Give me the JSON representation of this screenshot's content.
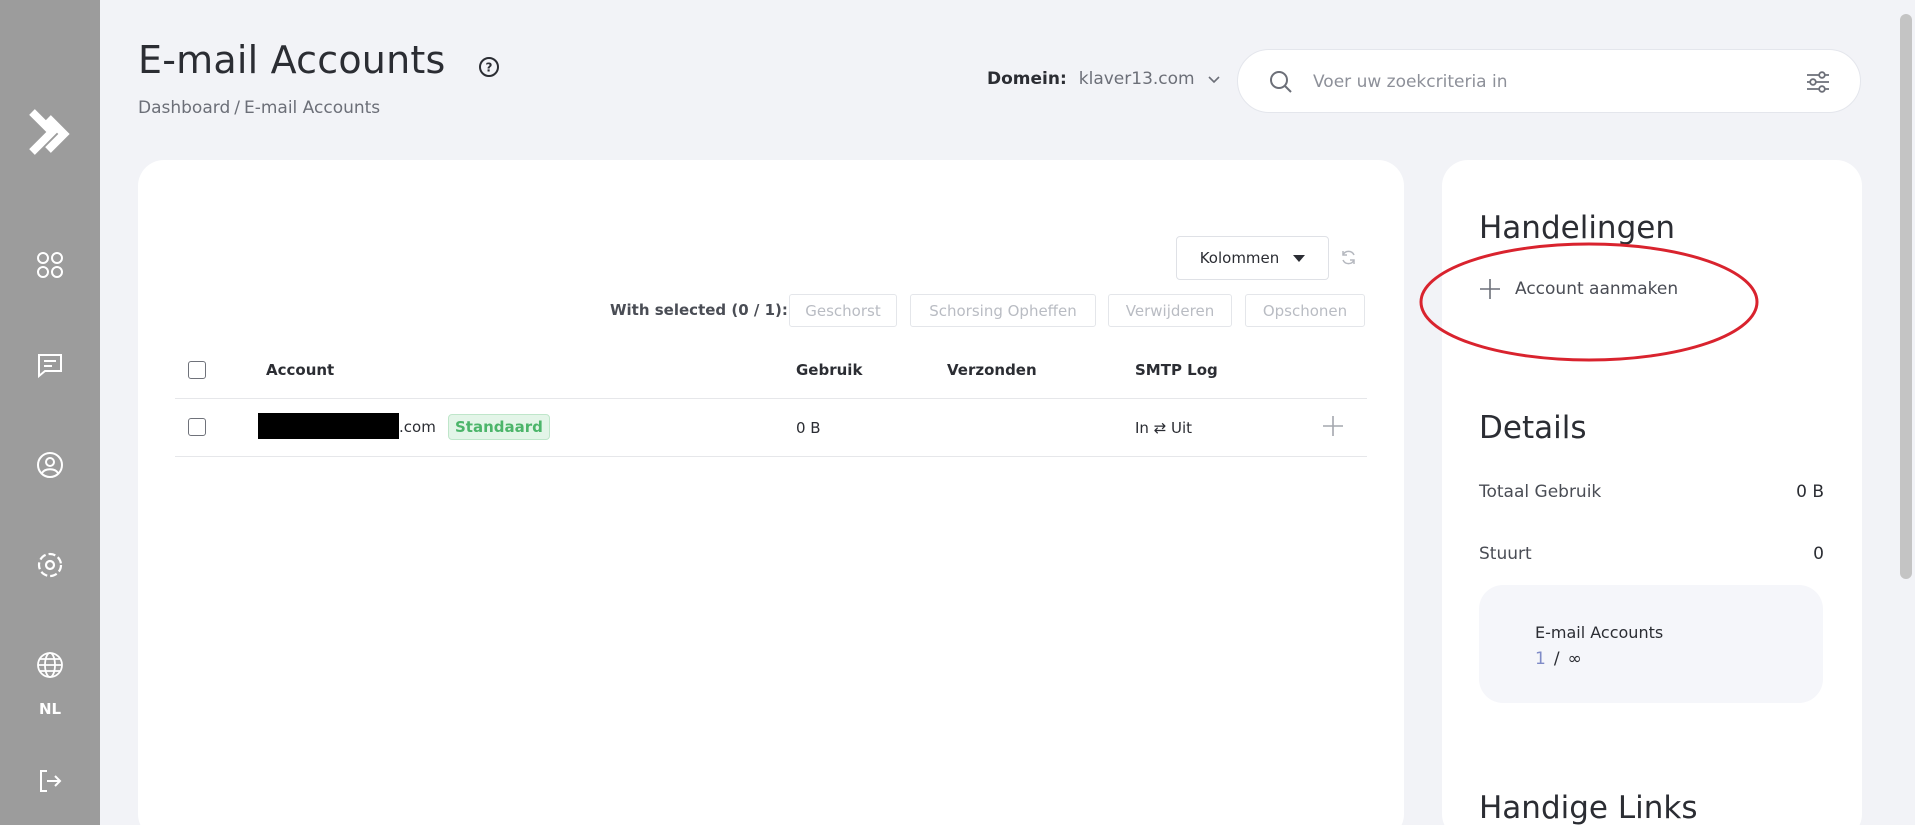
{
  "sidebar": {
    "items": [
      {
        "name": "logo"
      },
      {
        "name": "dashboard-icon"
      },
      {
        "name": "messages-icon"
      },
      {
        "name": "account-icon"
      },
      {
        "name": "settings-icon"
      },
      {
        "name": "language-icon"
      }
    ],
    "language": "NL"
  },
  "header": {
    "title": "E-mail Accounts",
    "breadcrumb": {
      "home": "Dashboard",
      "separator": "/",
      "current": "E-mail Accounts"
    },
    "domain_label": "Domein:",
    "domain_value": "klaver13.com"
  },
  "search": {
    "placeholder": "Voer uw zoekcriteria in"
  },
  "table": {
    "columns_button": "Kolommen",
    "with_selected": "With selected (0 / 1):",
    "bulk_actions": [
      "Geschorst",
      "Schorsing Opheffen",
      "Verwijderen",
      "Opschonen"
    ],
    "headers": {
      "account": "Account",
      "usage": "Gebruik",
      "sent": "Verzonden",
      "smtp_log": "SMTP Log"
    },
    "rows": [
      {
        "account_suffix": ".com",
        "badge": "Standaard",
        "usage": "0 B",
        "sent": "",
        "smtp_log": "In ⇄ Uit"
      }
    ]
  },
  "side": {
    "actions_title": "Handelingen",
    "create_account": "Account aanmaken",
    "details_title": "Details",
    "total_usage_label": "Totaal Gebruik",
    "total_usage_value": "0 B",
    "sends_label": "Stuurt",
    "sends_value": "0",
    "quota_label": "E-mail Accounts",
    "quota_used": "1",
    "quota_sep": "/",
    "quota_max": "∞",
    "links_title": "Handige Links"
  },
  "colors": {
    "sidebar": "#9c9c9c",
    "badge_green": "#4cb56a",
    "annotation_red": "#d9232e"
  }
}
